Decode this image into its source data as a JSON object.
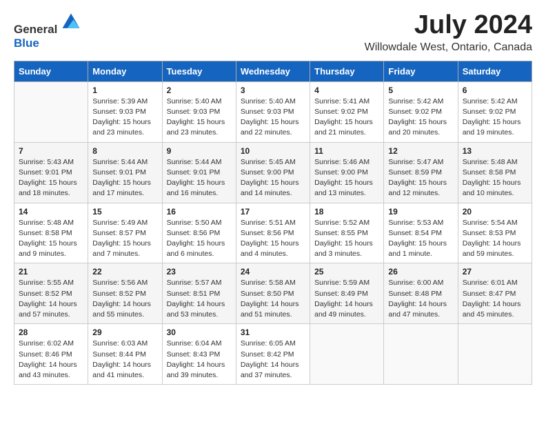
{
  "header": {
    "logo_general": "General",
    "logo_blue": "Blue",
    "title": "July 2024",
    "subtitle": "Willowdale West, Ontario, Canada"
  },
  "calendar": {
    "days_of_week": [
      "Sunday",
      "Monday",
      "Tuesday",
      "Wednesday",
      "Thursday",
      "Friday",
      "Saturday"
    ],
    "weeks": [
      [
        {
          "day": "",
          "info": ""
        },
        {
          "day": "1",
          "info": "Sunrise: 5:39 AM\nSunset: 9:03 PM\nDaylight: 15 hours\nand 23 minutes."
        },
        {
          "day": "2",
          "info": "Sunrise: 5:40 AM\nSunset: 9:03 PM\nDaylight: 15 hours\nand 23 minutes."
        },
        {
          "day": "3",
          "info": "Sunrise: 5:40 AM\nSunset: 9:03 PM\nDaylight: 15 hours\nand 22 minutes."
        },
        {
          "day": "4",
          "info": "Sunrise: 5:41 AM\nSunset: 9:02 PM\nDaylight: 15 hours\nand 21 minutes."
        },
        {
          "day": "5",
          "info": "Sunrise: 5:42 AM\nSunset: 9:02 PM\nDaylight: 15 hours\nand 20 minutes."
        },
        {
          "day": "6",
          "info": "Sunrise: 5:42 AM\nSunset: 9:02 PM\nDaylight: 15 hours\nand 19 minutes."
        }
      ],
      [
        {
          "day": "7",
          "info": "Sunrise: 5:43 AM\nSunset: 9:01 PM\nDaylight: 15 hours\nand 18 minutes."
        },
        {
          "day": "8",
          "info": "Sunrise: 5:44 AM\nSunset: 9:01 PM\nDaylight: 15 hours\nand 17 minutes."
        },
        {
          "day": "9",
          "info": "Sunrise: 5:44 AM\nSunset: 9:01 PM\nDaylight: 15 hours\nand 16 minutes."
        },
        {
          "day": "10",
          "info": "Sunrise: 5:45 AM\nSunset: 9:00 PM\nDaylight: 15 hours\nand 14 minutes."
        },
        {
          "day": "11",
          "info": "Sunrise: 5:46 AM\nSunset: 9:00 PM\nDaylight: 15 hours\nand 13 minutes."
        },
        {
          "day": "12",
          "info": "Sunrise: 5:47 AM\nSunset: 8:59 PM\nDaylight: 15 hours\nand 12 minutes."
        },
        {
          "day": "13",
          "info": "Sunrise: 5:48 AM\nSunset: 8:58 PM\nDaylight: 15 hours\nand 10 minutes."
        }
      ],
      [
        {
          "day": "14",
          "info": "Sunrise: 5:48 AM\nSunset: 8:58 PM\nDaylight: 15 hours\nand 9 minutes."
        },
        {
          "day": "15",
          "info": "Sunrise: 5:49 AM\nSunset: 8:57 PM\nDaylight: 15 hours\nand 7 minutes."
        },
        {
          "day": "16",
          "info": "Sunrise: 5:50 AM\nSunset: 8:56 PM\nDaylight: 15 hours\nand 6 minutes."
        },
        {
          "day": "17",
          "info": "Sunrise: 5:51 AM\nSunset: 8:56 PM\nDaylight: 15 hours\nand 4 minutes."
        },
        {
          "day": "18",
          "info": "Sunrise: 5:52 AM\nSunset: 8:55 PM\nDaylight: 15 hours\nand 3 minutes."
        },
        {
          "day": "19",
          "info": "Sunrise: 5:53 AM\nSunset: 8:54 PM\nDaylight: 15 hours\nand 1 minute."
        },
        {
          "day": "20",
          "info": "Sunrise: 5:54 AM\nSunset: 8:53 PM\nDaylight: 14 hours\nand 59 minutes."
        }
      ],
      [
        {
          "day": "21",
          "info": "Sunrise: 5:55 AM\nSunset: 8:52 PM\nDaylight: 14 hours\nand 57 minutes."
        },
        {
          "day": "22",
          "info": "Sunrise: 5:56 AM\nSunset: 8:52 PM\nDaylight: 14 hours\nand 55 minutes."
        },
        {
          "day": "23",
          "info": "Sunrise: 5:57 AM\nSunset: 8:51 PM\nDaylight: 14 hours\nand 53 minutes."
        },
        {
          "day": "24",
          "info": "Sunrise: 5:58 AM\nSunset: 8:50 PM\nDaylight: 14 hours\nand 51 minutes."
        },
        {
          "day": "25",
          "info": "Sunrise: 5:59 AM\nSunset: 8:49 PM\nDaylight: 14 hours\nand 49 minutes."
        },
        {
          "day": "26",
          "info": "Sunrise: 6:00 AM\nSunset: 8:48 PM\nDaylight: 14 hours\nand 47 minutes."
        },
        {
          "day": "27",
          "info": "Sunrise: 6:01 AM\nSunset: 8:47 PM\nDaylight: 14 hours\nand 45 minutes."
        }
      ],
      [
        {
          "day": "28",
          "info": "Sunrise: 6:02 AM\nSunset: 8:46 PM\nDaylight: 14 hours\nand 43 minutes."
        },
        {
          "day": "29",
          "info": "Sunrise: 6:03 AM\nSunset: 8:44 PM\nDaylight: 14 hours\nand 41 minutes."
        },
        {
          "day": "30",
          "info": "Sunrise: 6:04 AM\nSunset: 8:43 PM\nDaylight: 14 hours\nand 39 minutes."
        },
        {
          "day": "31",
          "info": "Sunrise: 6:05 AM\nSunset: 8:42 PM\nDaylight: 14 hours\nand 37 minutes."
        },
        {
          "day": "",
          "info": ""
        },
        {
          "day": "",
          "info": ""
        },
        {
          "day": "",
          "info": ""
        }
      ]
    ]
  }
}
